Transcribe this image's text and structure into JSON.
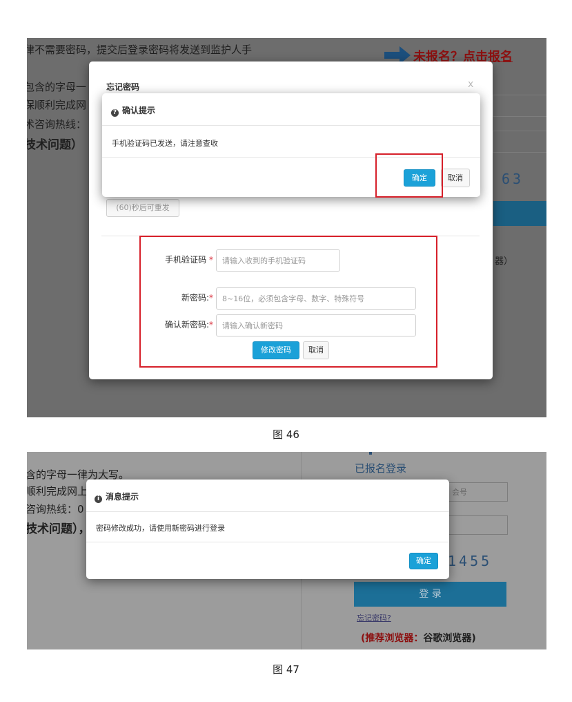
{
  "figure1": {
    "caption": "图 46",
    "background": {
      "line1": "律不需要密码，提交后登录密码将发送到监护人手",
      "line2": "包含的字母一",
      "line3": "保顺利完成网",
      "line4": "术咨询热线：",
      "line5": "技术问题）",
      "register_link": "未报名？点击报名",
      "captcha_partial": "63",
      "recommend_partial": "器）"
    },
    "forgot_modal": {
      "title": "忘记密码",
      "close_label": "x",
      "resend_button": "(60)秒后可重发",
      "fields": [
        {
          "label": "手机验证码",
          "required_mark": "*",
          "placeholder": "请输入收到的手机验证码"
        },
        {
          "label": "新密码:",
          "required_mark": "*",
          "placeholder": "8~16位，必须包含字母、数字、特殊符号"
        },
        {
          "label": "确认新密码:",
          "required_mark": "*",
          "placeholder": "请输入确认新密码"
        }
      ],
      "submit_button": "修改密码",
      "cancel_button": "取消"
    },
    "confirm_dialog": {
      "title": "确认提示",
      "icon": "question-circle-icon",
      "message": "手机验证码已发送，请注意查收",
      "ok_button": "确定",
      "cancel_button": "取消"
    }
  },
  "figure2": {
    "caption": "图 47",
    "background": {
      "line1": "含的字母一律为大写。",
      "line2": "顺利完成网上",
      "line3": "咨询热线：0",
      "line4": "技术问题），",
      "login_title": "已报名登录",
      "input_partial": "会号",
      "captcha_partial": "1455",
      "login_button": "登 录",
      "forgot_link": "忘记密码?",
      "recommend_label": "(推荐浏览器：",
      "recommend_browser": "谷歌浏览器)"
    },
    "message_dialog": {
      "title": "消息提示",
      "icon": "info-circle-icon",
      "message": "密码修改成功，请使用新密码进行登录",
      "ok_button": "确定"
    }
  },
  "colors": {
    "primary_button": "#1ba1d8",
    "highlight_box": "#d6202a",
    "overlay_dark": "#6d6d6d"
  }
}
